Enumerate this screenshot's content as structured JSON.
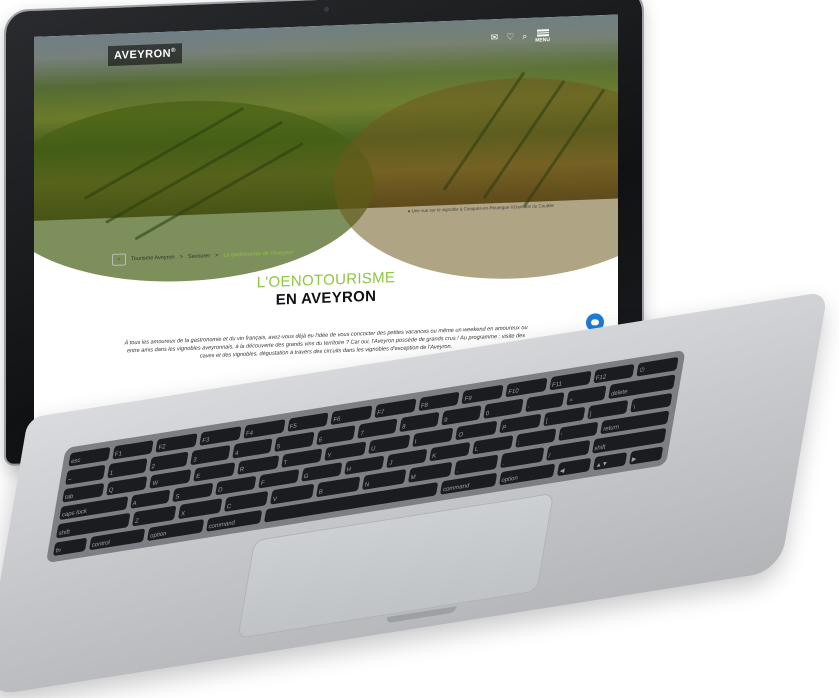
{
  "site": {
    "logo": "AVEYRON",
    "logo_mark": "®",
    "header_icons": [
      "mail-icon",
      "heart-icon",
      "search-icon"
    ],
    "menu_label": "MENU"
  },
  "hero": {
    "caption": "Une vue sur le vignoble à Conques-en-Rouergue ©Damarie du Coutble"
  },
  "breadcrumb": {
    "items": [
      "Tourisme Aveyron",
      "Savourer",
      "La gastronomie de l'Aveyron"
    ],
    "separators": [
      ">",
      ">"
    ]
  },
  "page": {
    "title_line1": "L'OENOTOURISME",
    "title_line2": "EN AVEYRON",
    "intro": "À tous les amoureux de la gastronomie et du vin français, avez-vous déjà eu l'idée de vous concocter des petites vacances ou même un weekend en amoureux ou entre amis dans les vignobles aveyronnais, à la découverte des grands vins du territoire ? Car oui, l'Aveyron possède de grands crus ! Au programme : visite des caves et des vignobles, dégustation à travers des circuits dans les vignobles d'exception de l'Aveyron."
  },
  "colors": {
    "accent": "#8dc63f",
    "chat": "#1f7ad8"
  },
  "keyboard": {
    "rows": [
      [
        "esc",
        "F1",
        "F2",
        "F3",
        "F4",
        "F5",
        "F6",
        "F7",
        "F8",
        "F9",
        "F10",
        "F11",
        "F12",
        "⏻"
      ],
      [
        "~",
        "1",
        "2",
        "3",
        "4",
        "5",
        "6",
        "7",
        "8",
        "9",
        "0",
        "-",
        "=",
        "delete"
      ],
      [
        "tab",
        "Q",
        "W",
        "E",
        "R",
        "T",
        "Y",
        "U",
        "I",
        "O",
        "P",
        "[",
        "]",
        "\\"
      ],
      [
        "caps lock",
        "A",
        "S",
        "D",
        "F",
        "G",
        "H",
        "J",
        "K",
        "L",
        ";",
        "'",
        "return"
      ],
      [
        "shift",
        "Z",
        "X",
        "C",
        "V",
        "B",
        "N",
        "M",
        ",",
        ".",
        "/",
        "shift"
      ],
      [
        "fn",
        "control",
        "option",
        "command",
        "",
        "command",
        "option",
        "◀",
        "▲▼",
        "▶"
      ]
    ]
  }
}
